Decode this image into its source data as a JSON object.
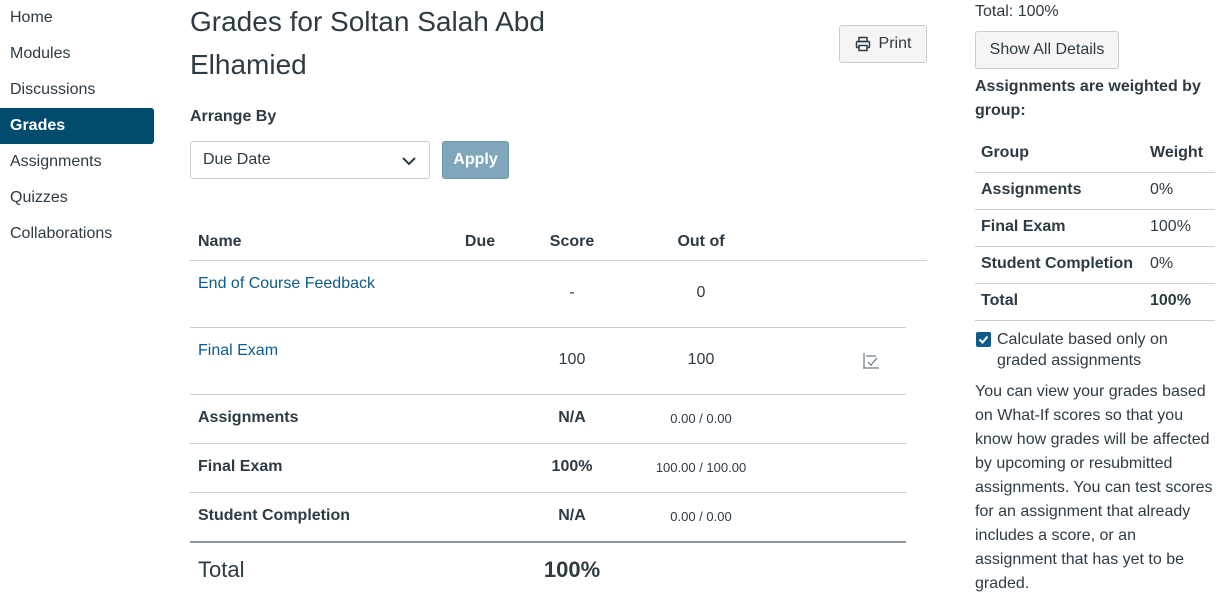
{
  "nav": {
    "items": [
      {
        "label": "Home"
      },
      {
        "label": "Modules"
      },
      {
        "label": "Discussions"
      },
      {
        "label": "Grades"
      },
      {
        "label": "Assignments"
      },
      {
        "label": "Quizzes"
      },
      {
        "label": "Collaborations"
      }
    ],
    "active": "Grades"
  },
  "header": {
    "title": "Grades for Soltan Salah Abd Elhamied",
    "print_label": "Print"
  },
  "arrange": {
    "label": "Arrange By",
    "selected": "Due Date",
    "apply_label": "Apply"
  },
  "table": {
    "columns": {
      "name": "Name",
      "due": "Due",
      "score": "Score",
      "out_of": "Out of"
    },
    "assignments": [
      {
        "name": "End of Course Feedback",
        "due": "",
        "score": "-",
        "out_of": "0"
      },
      {
        "name": "Final Exam",
        "due": "",
        "score": "100",
        "out_of": "100"
      }
    ],
    "groups": [
      {
        "name": "Assignments",
        "score": "N/A",
        "out_of": "0.00 / 0.00"
      },
      {
        "name": "Final Exam",
        "score": "100%",
        "out_of": "100.00 / 100.00"
      },
      {
        "name": "Student Completion",
        "score": "N/A",
        "out_of": "0.00 / 0.00"
      }
    ],
    "total": {
      "label": "Total",
      "score": "100%"
    }
  },
  "sidebar": {
    "total_text": "Total: 100%",
    "show_details_label": "Show All Details",
    "weighted_note": "Assignments are weighted by group:",
    "weights": {
      "headers": {
        "group": "Group",
        "weight": "Weight"
      },
      "rows": [
        {
          "group": "Assignments",
          "weight": "0%"
        },
        {
          "group": "Final Exam",
          "weight": "100%"
        },
        {
          "group": "Student Completion",
          "weight": "0%"
        },
        {
          "group": "Total",
          "weight": "100%"
        }
      ]
    },
    "checkbox_label": "Calculate based only on graded assignments",
    "checkbox_checked": true,
    "whatif_text": "You can view your grades based on What-If scores so that you know how grades will be affected by upcoming or resubmitted assignments. You can test scores for an assignment that already includes a score, or an assignment that has yet to be graded."
  },
  "colors": {
    "nav_active_bg": "#004b6e",
    "link": "#0e5a8a",
    "apply_bg": "#7fa6ba",
    "text": "#2d3b45"
  }
}
